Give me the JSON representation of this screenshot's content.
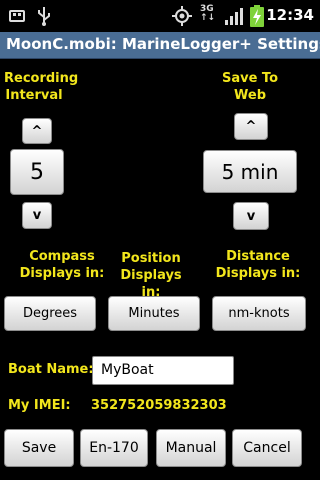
{
  "status_bar": {
    "time": "12:34",
    "icons": [
      "usb-debug-icon",
      "usb-icon",
      "location-icon",
      "3g-icon",
      "signal-icon",
      "battery-charging-icon"
    ]
  },
  "app": {
    "title": "MoonC.mobi: MarineLogger+ Settings"
  },
  "recording_interval": {
    "label": "Recording Interval",
    "up_label": "^",
    "value": "5",
    "down_label": "v"
  },
  "save_to_web": {
    "label": "Save To Web",
    "up_label": "^",
    "value": "5 min",
    "down_label": "v"
  },
  "units": {
    "compass": {
      "label": "Compass Displays in:",
      "value": "Degrees"
    },
    "position": {
      "label": "Position Displays in:",
      "value": "Minutes"
    },
    "distance": {
      "label": "Distance Displays in:",
      "value": "nm-knots"
    }
  },
  "boat_name": {
    "label": "Boat Name:",
    "value": "MyBoat"
  },
  "imei": {
    "label": "My IMEI:",
    "value": "352752059832303"
  },
  "actions": {
    "save": "Save",
    "model": "En-170",
    "manual": "Manual",
    "cancel": "Cancel"
  }
}
